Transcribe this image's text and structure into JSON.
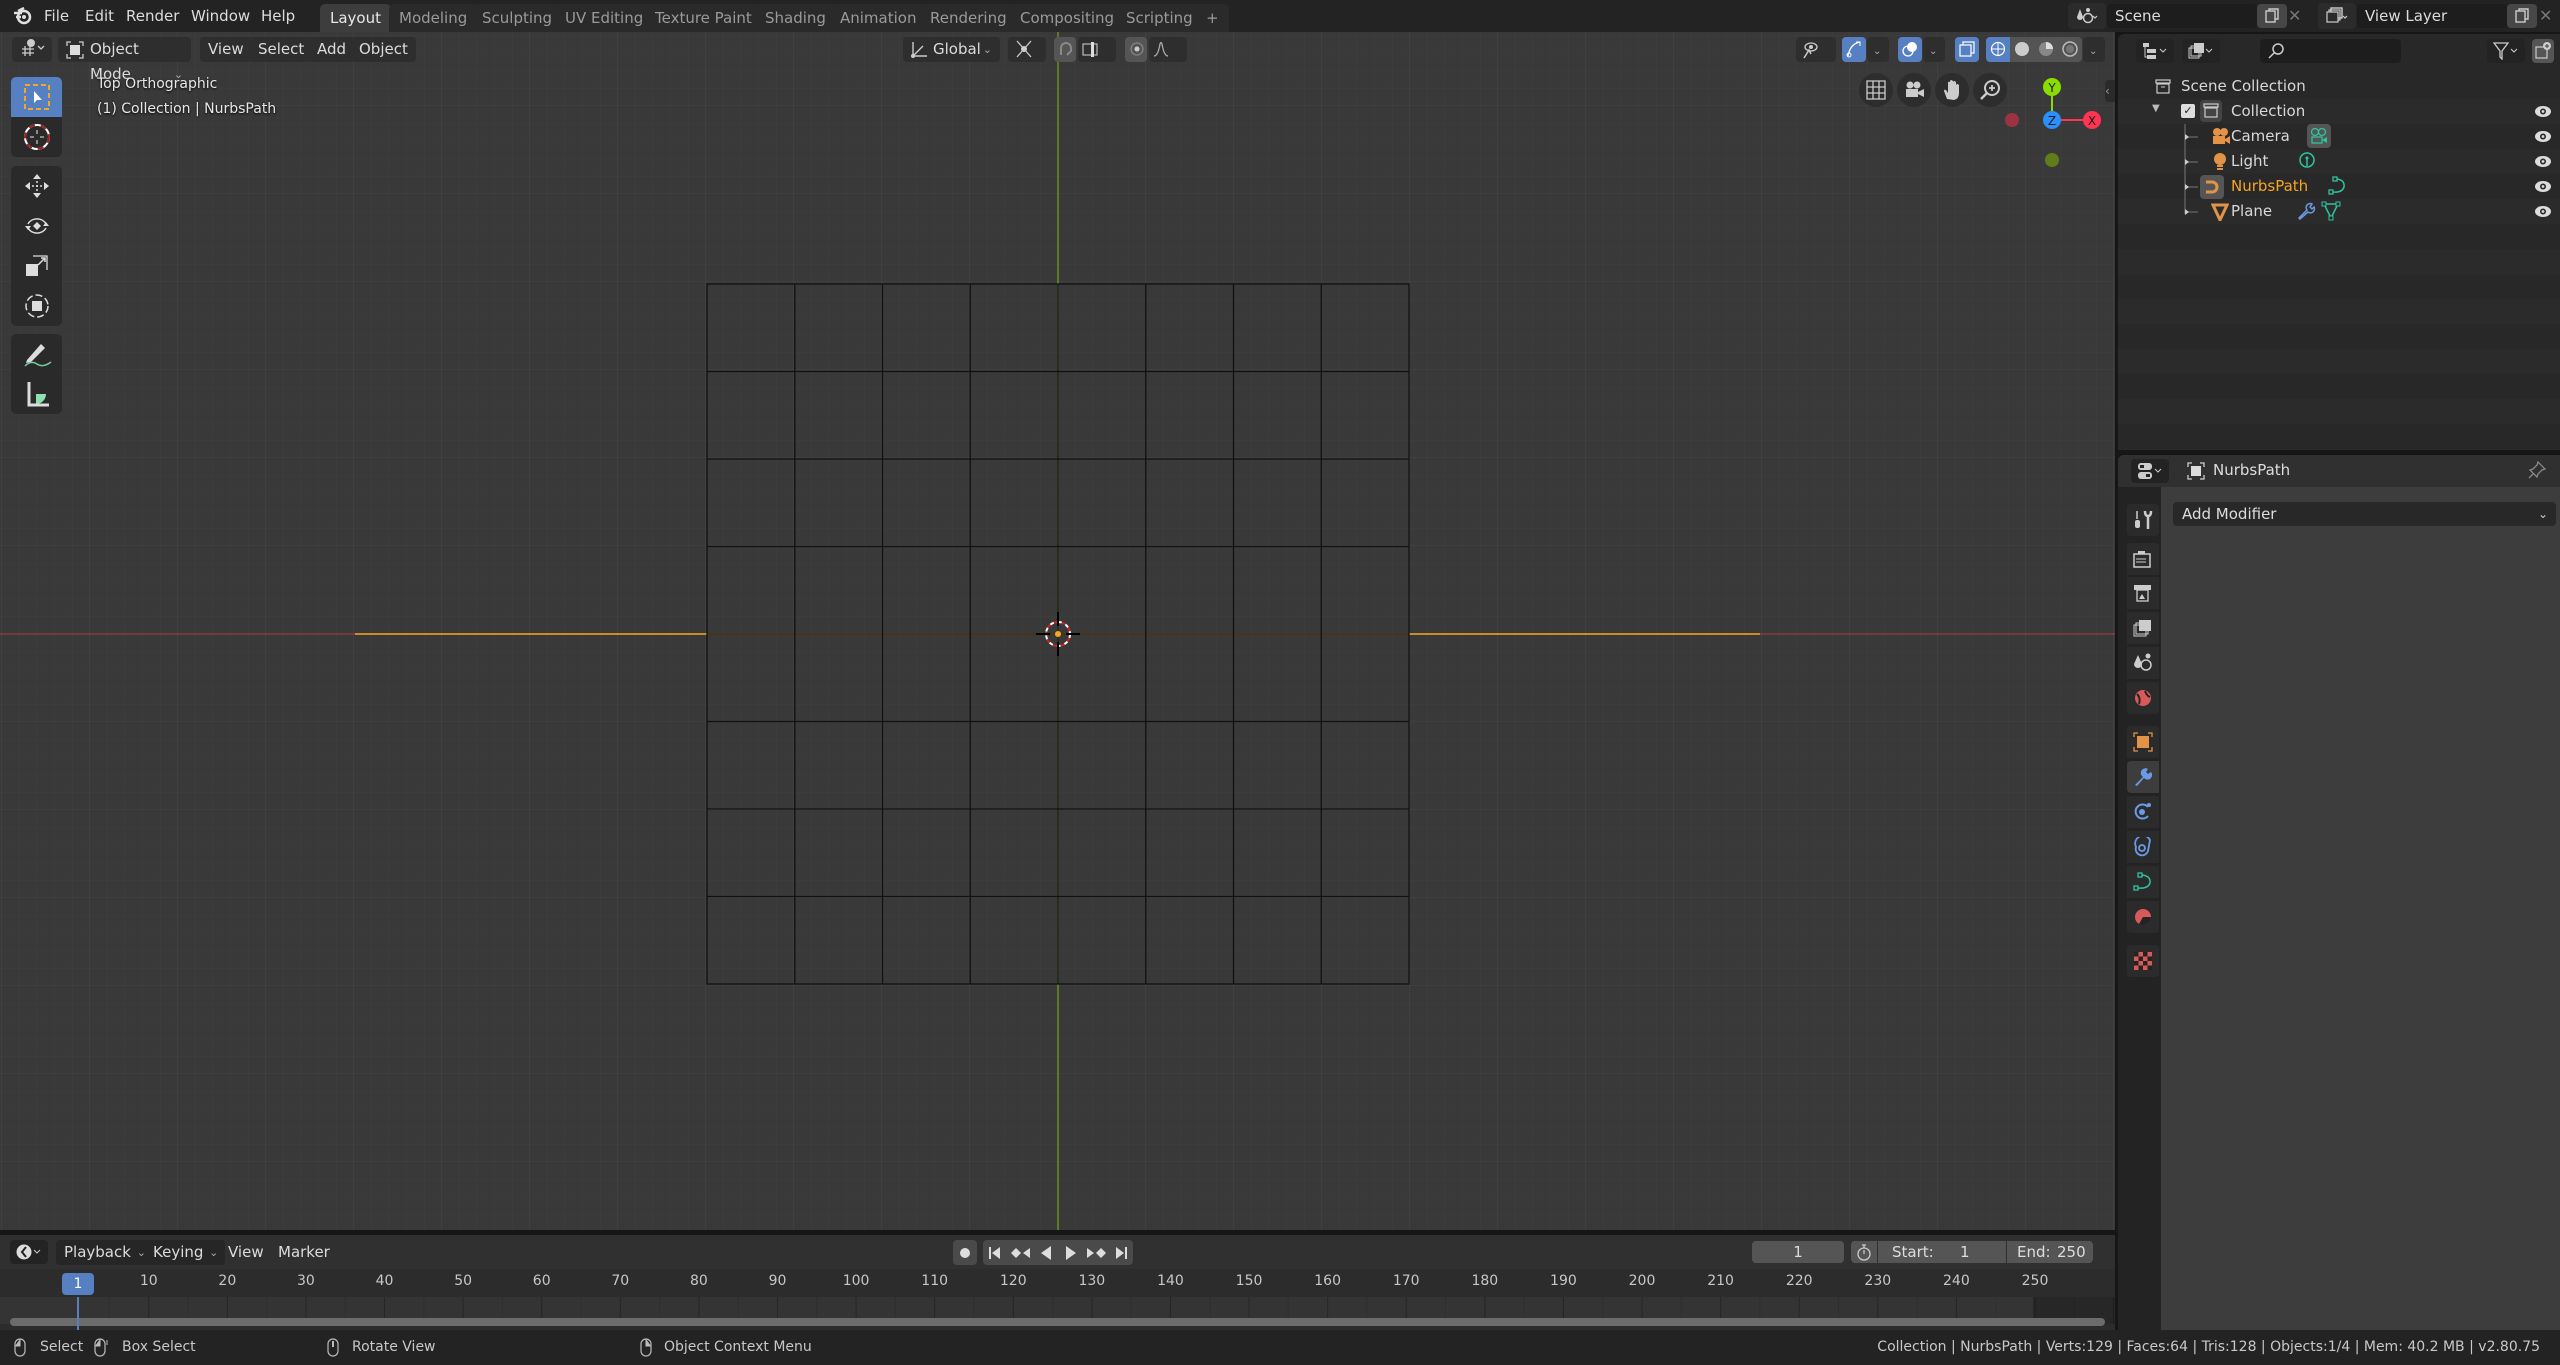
{
  "app": {
    "logo_icon": "blender-logo-icon"
  },
  "menu": {
    "items": [
      "File",
      "Edit",
      "Render",
      "Window",
      "Help"
    ]
  },
  "workspaces": {
    "tabs": [
      "Layout",
      "Modeling",
      "Sculpting",
      "UV Editing",
      "Texture Paint",
      "Shading",
      "Animation",
      "Rendering",
      "Compositing",
      "Scripting"
    ],
    "active": "Layout",
    "add_icon": "+"
  },
  "scene": {
    "label": "Scene",
    "view_layer": "View Layer"
  },
  "viewport": {
    "header": {
      "mode": "Object Mode",
      "menus": [
        "View",
        "Select",
        "Add",
        "Object"
      ],
      "transform_orientation": "Global"
    },
    "overlay_text": {
      "view_name": "Top Orthographic",
      "context": "(1) Collection | NurbsPath"
    },
    "gizmo": {
      "x": "X",
      "y": "Y",
      "z": "Z"
    },
    "colors": {
      "x_axis": "#ff3352",
      "y_axis": "#8bdc00",
      "z_axis": "#2890ff",
      "active_tool": "#5680c2",
      "selected_object": "#f5a623"
    },
    "tools": [
      "select-box",
      "cursor",
      "move",
      "rotate",
      "scale",
      "transform",
      "annotate",
      "measure"
    ],
    "grid_mesh": {
      "subdivisions": 8
    }
  },
  "outliner": {
    "search_placeholder": "",
    "root": "Scene Collection",
    "collection": "Collection",
    "items": [
      {
        "name": "Camera",
        "type": "camera",
        "selected": false
      },
      {
        "name": "Light",
        "type": "light",
        "selected": false
      },
      {
        "name": "NurbsPath",
        "type": "curve",
        "selected": true
      },
      {
        "name": "Plane",
        "type": "mesh",
        "selected": false
      }
    ]
  },
  "properties": {
    "object_name": "NurbsPath",
    "add_modifier_label": "Add Modifier",
    "active_tab": "modifiers",
    "tabs": [
      "tool",
      "render",
      "output",
      "view-layer",
      "scene",
      "world",
      "object",
      "modifiers",
      "particles",
      "physics",
      "object-data-curve",
      "material",
      "texture"
    ]
  },
  "timeline": {
    "menus": [
      "Playback",
      "Keying",
      "View",
      "Marker"
    ],
    "current_frame": "1",
    "start_label": "Start:",
    "start": "1",
    "end_label": "End:",
    "end": "250",
    "ticks": [
      "10",
      "20",
      "30",
      "40",
      "50",
      "60",
      "70",
      "80",
      "90",
      "100",
      "110",
      "120",
      "130",
      "140",
      "150",
      "160",
      "170",
      "180",
      "190",
      "200",
      "210",
      "220",
      "230",
      "240",
      "250"
    ],
    "playhead": "1"
  },
  "statusbar": {
    "select": "Select",
    "box_select": "Box Select",
    "rotate_view": "Rotate View",
    "context_menu": "Object Context Menu",
    "stats": "Collection | NurbsPath | Verts:129 | Faces:64 | Tris:128 | Objects:1/4 | Mem: 40.2 MB | v2.80.75"
  }
}
